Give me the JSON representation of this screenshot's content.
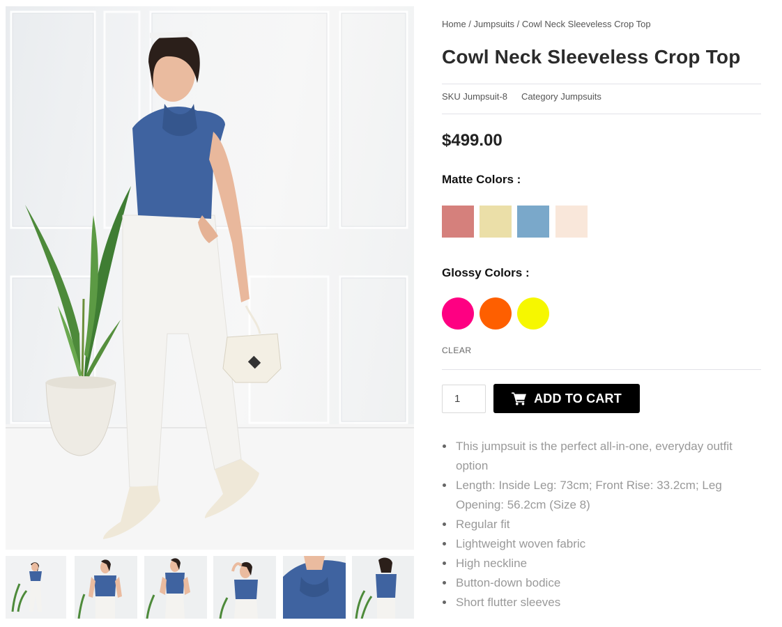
{
  "breadcrumb": {
    "home": "Home",
    "separator1": " / ",
    "category": "Jumpsuits",
    "separator2": " / ",
    "current": "Cowl Neck Sleeveless Crop Top"
  },
  "product": {
    "title": "Cowl Neck Sleeveless Crop Top",
    "sku_label": "SKU",
    "sku_value": "Jumpsuit-8",
    "category_label": "Category",
    "category_value": "Jumpsuits",
    "price": "$499.00"
  },
  "attributes": {
    "matte": {
      "label": "Matte Colors :",
      "swatches": [
        {
          "color": "#d5807c"
        },
        {
          "color": "#ebdfa8"
        },
        {
          "color": "#7aa8ca"
        },
        {
          "color": "#f9e7da"
        }
      ]
    },
    "glossy": {
      "label": "Glossy Colors :",
      "swatches": [
        {
          "color": "#fe0082"
        },
        {
          "color": "#fe5f00"
        },
        {
          "color": "#f6f700"
        }
      ]
    },
    "clear_label": "CLEAR"
  },
  "cart": {
    "quantity": "1",
    "button_label": "ADD TO CART",
    "button_icon": "cart-icon"
  },
  "features": [
    "This jumpsuit is the perfect all-in-one, everyday outfit option",
    "Length: Inside Leg: 73cm; Front Rise: 33.2cm; Leg Opening: 56.2cm (Size 8)",
    "Regular fit",
    "Lightweight woven fabric",
    "High neckline",
    "Button-down bodice",
    "Short flutter sleeves"
  ],
  "gallery": {
    "thumbnail_count": 6
  },
  "colors": {
    "top_blue": "#3f63a0",
    "pants_white": "#f4f3f0",
    "plant_green": "#4d8a3a",
    "pot": "#eeebe4",
    "button_bg": "#000000"
  }
}
